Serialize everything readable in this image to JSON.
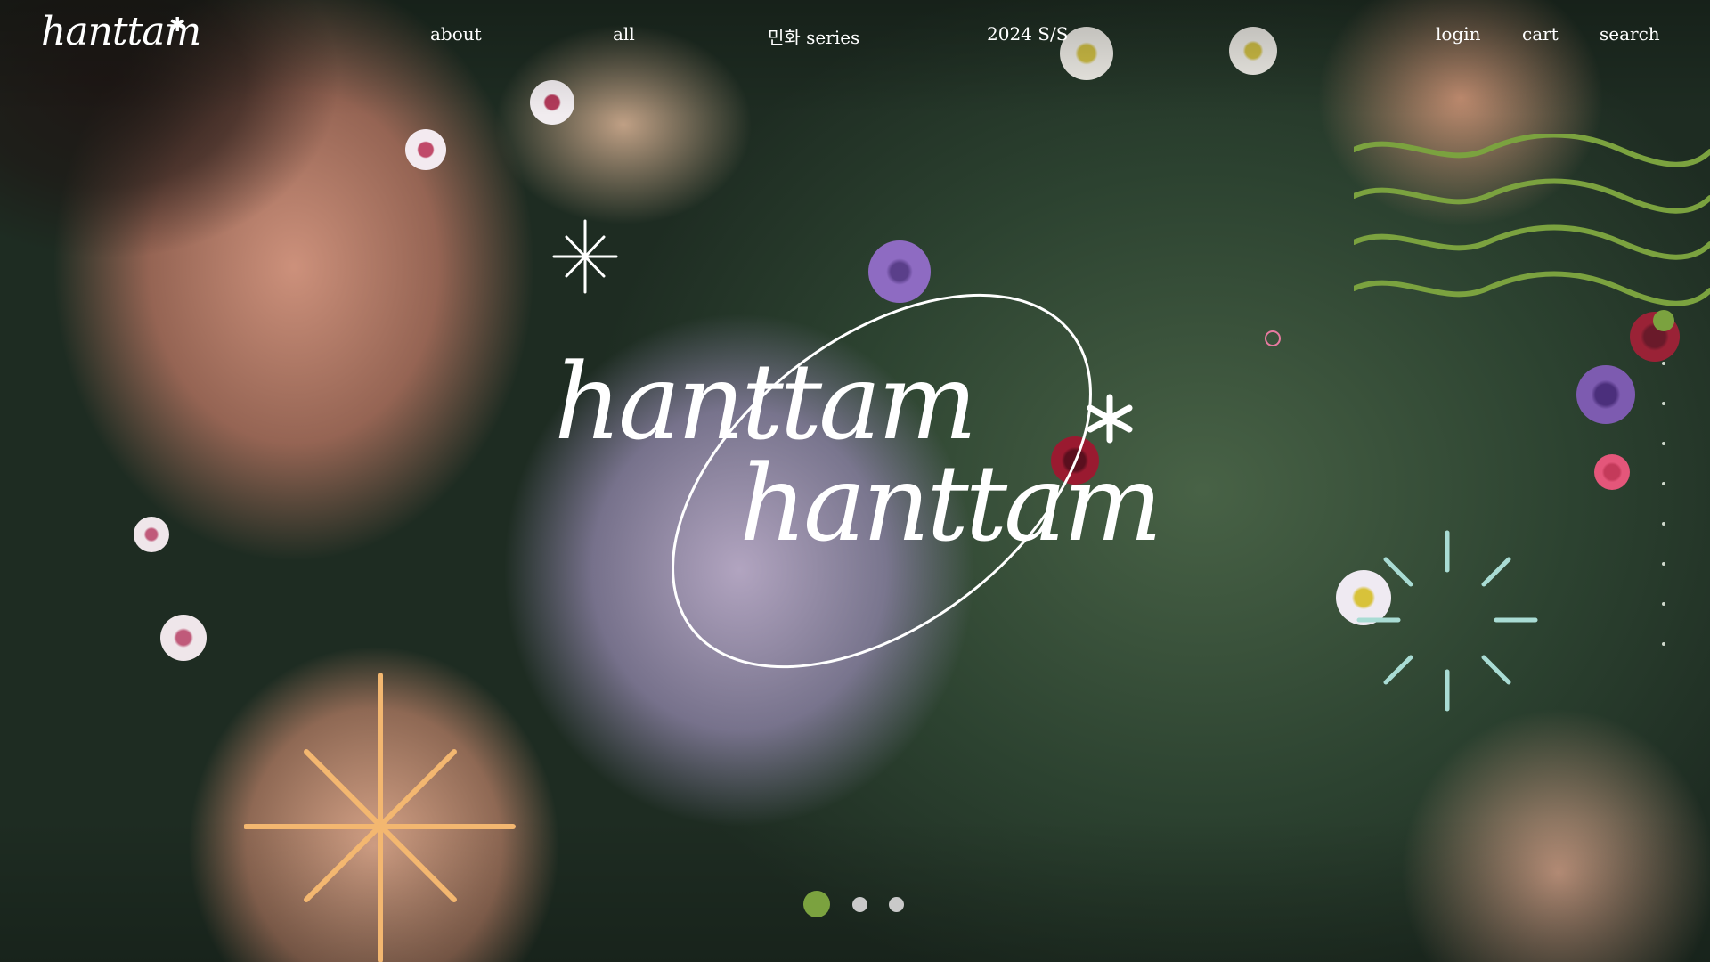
{
  "brand": {
    "logo_text": "hanttam",
    "hero_title_line1": "hanttam",
    "hero_title_line2": "hanttam"
  },
  "nav": {
    "left": [
      {
        "label": "about"
      },
      {
        "label": "all"
      },
      {
        "label": "민화 series"
      },
      {
        "label": "2024 S/S"
      }
    ],
    "right": [
      {
        "label": "login"
      },
      {
        "label": "cart"
      },
      {
        "label": "search"
      }
    ]
  },
  "slider": {
    "total_slides": 3,
    "active_slide": 1
  },
  "colors": {
    "text": "#ffffff",
    "accent_green": "#7ba23f",
    "accent_orange": "#f3b770",
    "accent_teal": "#a9dcd4",
    "accent_pink": "#e87aa0",
    "dot_inactive": "#c9c9c9"
  },
  "icons": {
    "logo_star": "asterisk-icon",
    "title_star": "asterisk-icon",
    "sparkle_small": "sparkle-icon",
    "sparkle_large": "starburst-icon",
    "burst": "burst-icon",
    "waves": "wave-lines-icon",
    "ring": "ring-icon"
  }
}
